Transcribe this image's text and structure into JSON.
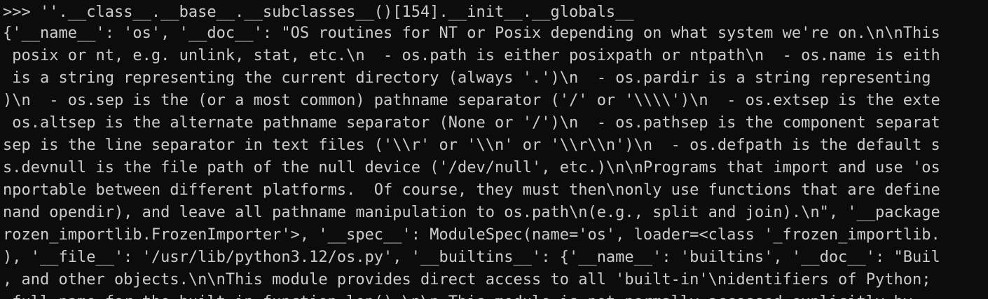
{
  "terminal": {
    "prompt": ">>> ",
    "command": "''.__class__.__base__.__subclasses__()[154].__init__.__globals__",
    "output_lines": [
      "{'__name__': 'os', '__doc__': \"OS routines for NT or Posix depending on what system we're on.\\n\\nThis",
      " posix or nt, e.g. unlink, stat, etc.\\n  - os.path is either posixpath or ntpath\\n  - os.name is eith",
      " is a string representing the current directory (always '.')\\n  - os.pardir is a string representing",
      ")\\n  - os.sep is the (or a most common) pathname separator ('/' or '\\\\\\\\')\\n  - os.extsep is the exte",
      " os.altsep is the alternate pathname separator (None or '/')\\n  - os.pathsep is the component separat",
      "sep is the line separator in text files ('\\\\r' or '\\\\n' or '\\\\r\\\\n')\\n  - os.defpath is the default s",
      "s.devnull is the file path of the null device ('/dev/null', etc.)\\n\\nPrograms that import and use 'os",
      "nportable between different platforms.  Of course, they must then\\nonly use functions that are define",
      "nand opendir), and leave all pathname manipulation to os.path\\n(e.g., split and join).\\n\", '__package",
      "rozen_importlib.FrozenImporter'>, '__spec__': ModuleSpec(name='os', loader=<class '_frozen_importlib.",
      "), '__file__': '/usr/lib/python3.12/os.py', '__builtins__': {'__name__': 'builtins', '__doc__': \"Buil",
      ", and other objects.\\n\\nThis module provides direct access to all 'built-in'\\nidentifiers of Python;",
      " full name for the built-in function len().\\n\\n This module is not normally accessed explicitly by"
    ]
  },
  "colors": {
    "background": "#0c0c0c",
    "foreground": "#cccccc"
  }
}
